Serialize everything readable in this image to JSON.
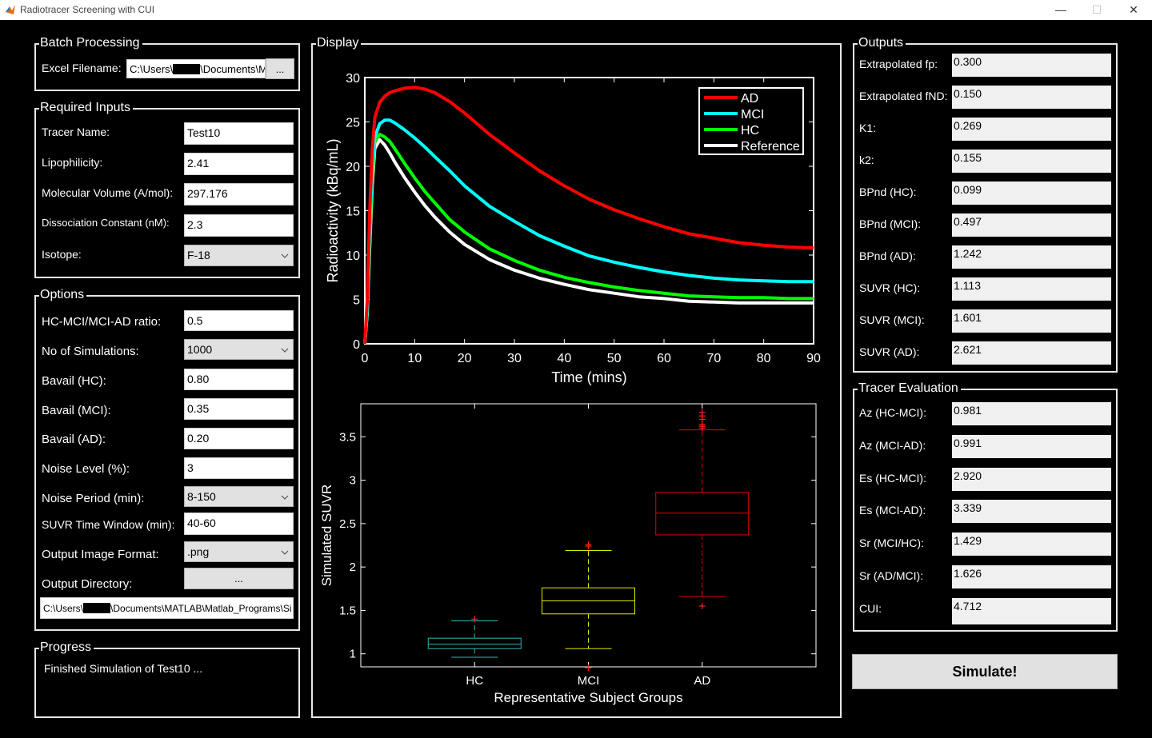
{
  "window": {
    "title": "Radiotracer Screening with CUI",
    "minimize": "—",
    "maximize": "☐",
    "close": "✕"
  },
  "batch": {
    "title": "Batch Processing",
    "excel_label": "Excel Filename:",
    "excel_path_prefix": "C:\\Users\\",
    "excel_path_suffix": "\\Documents\\M",
    "browse_label": "..."
  },
  "required": {
    "title": "Required Inputs",
    "fields": [
      {
        "label": "Tracer Name:",
        "value": "Test10"
      },
      {
        "label": "Lipophilicity:",
        "value": "2.41"
      },
      {
        "label": "Molecular Volume (A/mol):",
        "value": "297.176"
      },
      {
        "label": "Dissociation Constant (nM):",
        "value": "2.3"
      },
      {
        "label": "Isotope:",
        "value": "F-18"
      }
    ]
  },
  "options": {
    "title": "Options",
    "fields": [
      {
        "label": "HC-MCI/MCI-AD ratio:",
        "value": "0.5"
      },
      {
        "label": "No of Simulations:",
        "value": "1000"
      },
      {
        "label": "Bavail (HC):",
        "value": "0.80"
      },
      {
        "label": "Bavail (MCI):",
        "value": "0.35"
      },
      {
        "label": "Bavail (AD):",
        "value": "0.20"
      },
      {
        "label": "Noise Level (%):",
        "value": "3"
      },
      {
        "label": "Noise Period (min):",
        "value": "8-150"
      },
      {
        "label": "SUVR Time Window (min):",
        "value": "40-60"
      },
      {
        "label": "Output Image Format:",
        "value": ".png"
      },
      {
        "label": "Output Directory:",
        "value": "..."
      }
    ],
    "dir_path_prefix": "C:\\Users\\",
    "dir_path_suffix": "\\Documents\\MATLAB\\Matlab_Programs\\Si"
  },
  "progress": {
    "title": "Progress",
    "message": "Finished Simulation of Test10 ..."
  },
  "display": {
    "title": "Display"
  },
  "outputs": {
    "title": "Outputs",
    "items": [
      {
        "label": "Extrapolated fp:",
        "value": "0.300"
      },
      {
        "label": "Extrapolated fND:",
        "value": "0.150"
      },
      {
        "label": "K1:",
        "value": "0.269"
      },
      {
        "label": "k2:",
        "value": "0.155"
      },
      {
        "label": "BPnd (HC):",
        "value": "0.099"
      },
      {
        "label": "BPnd (MCI):",
        "value": "0.497"
      },
      {
        "label": "BPnd (AD):",
        "value": "1.242"
      },
      {
        "label": "SUVR (HC):",
        "value": "1.113"
      },
      {
        "label": "SUVR (MCI):",
        "value": "1.601"
      },
      {
        "label": "SUVR (AD):",
        "value": "2.621"
      }
    ]
  },
  "evaluation": {
    "title": "Tracer Evaluation",
    "items": [
      {
        "label": "Az (HC-MCI):",
        "value": "0.981"
      },
      {
        "label": "Az (MCI-AD):",
        "value": "0.991"
      },
      {
        "label": "Es (HC-MCI):",
        "value": "2.920"
      },
      {
        "label": "Es (MCI-AD):",
        "value": "3.339"
      },
      {
        "label": "Sr (MCI/HC):",
        "value": "1.429"
      },
      {
        "label": "Sr (AD/MCI):",
        "value": "1.626"
      },
      {
        "label": "CUI:",
        "value": "4.712"
      }
    ]
  },
  "simulate_label": "Simulate!",
  "chart_data": [
    {
      "type": "line",
      "xlabel": "Time (mins)",
      "ylabel": "Radioactivity (kBq/mL)",
      "xlim": [
        0,
        90
      ],
      "ylim": [
        0,
        30
      ],
      "xticks": [
        0,
        10,
        20,
        30,
        40,
        50,
        60,
        70,
        80,
        90
      ],
      "yticks": [
        0,
        5,
        10,
        15,
        20,
        25,
        30
      ],
      "legend_position": "top-right",
      "series": [
        {
          "name": "AD",
          "color": "#ff0000",
          "x": [
            0,
            0.5,
            1,
            1.5,
            2,
            3,
            4,
            5,
            6,
            8,
            10,
            12,
            14,
            17,
            20,
            25,
            30,
            35,
            40,
            45,
            50,
            55,
            60,
            65,
            70,
            75,
            80,
            85,
            90
          ],
          "y": [
            0,
            5,
            15,
            22,
            25.5,
            27.2,
            27.9,
            28.3,
            28.5,
            28.8,
            28.9,
            28.7,
            28.3,
            27.3,
            26.0,
            23.6,
            21.5,
            19.5,
            17.8,
            16.3,
            15.1,
            14.1,
            13.2,
            12.4,
            11.9,
            11.4,
            11.1,
            10.9,
            10.8
          ]
        },
        {
          "name": "MCI",
          "color": "#00ffff",
          "x": [
            0,
            0.5,
            1,
            1.5,
            2,
            3,
            4,
            5,
            6,
            8,
            10,
            12,
            14,
            17,
            20,
            25,
            30,
            35,
            40,
            45,
            50,
            55,
            60,
            65,
            70,
            75,
            80,
            85,
            90
          ],
          "y": [
            0,
            4,
            13,
            20,
            23.3,
            24.8,
            25.2,
            25.2,
            24.9,
            24.1,
            23.2,
            22.2,
            21.1,
            19.5,
            17.8,
            15.5,
            13.8,
            12.2,
            11.0,
            9.9,
            9.2,
            8.6,
            8.1,
            7.7,
            7.4,
            7.2,
            7.1,
            7.0,
            7.0
          ]
        },
        {
          "name": "HC",
          "color": "#00ff00",
          "x": [
            0,
            0.5,
            1,
            1.5,
            2,
            3,
            4,
            5,
            6,
            8,
            10,
            12,
            14,
            17,
            20,
            25,
            30,
            35,
            40,
            45,
            50,
            55,
            60,
            65,
            70,
            75,
            80,
            85,
            90
          ],
          "y": [
            0,
            4,
            12,
            19,
            22.8,
            23.6,
            23.3,
            22.8,
            22.0,
            20.3,
            18.7,
            17.2,
            15.9,
            14.0,
            12.6,
            10.7,
            9.4,
            8.3,
            7.5,
            6.9,
            6.4,
            6.0,
            5.7,
            5.4,
            5.3,
            5.2,
            5.2,
            5.1,
            5.1
          ]
        },
        {
          "name": "Reference",
          "color": "#ffffff",
          "x": [
            0,
            0.5,
            1,
            1.5,
            2,
            3,
            4,
            5,
            6,
            8,
            10,
            12,
            14,
            17,
            20,
            25,
            30,
            35,
            40,
            45,
            50,
            55,
            60,
            65,
            70,
            75,
            80,
            85,
            90
          ],
          "y": [
            0,
            3.5,
            11,
            18,
            22,
            23.0,
            22.4,
            21.5,
            20.5,
            18.7,
            17.1,
            15.6,
            14.3,
            12.6,
            11.2,
            9.5,
            8.3,
            7.4,
            6.7,
            6.1,
            5.7,
            5.3,
            5.1,
            4.8,
            4.7,
            4.6,
            4.6,
            4.6,
            4.6
          ]
        }
      ]
    },
    {
      "type": "box",
      "xlabel": "Representative Subject Groups",
      "ylabel": "Simulated SUVR",
      "categories": [
        "HC",
        "MCI",
        "AD"
      ],
      "ylim": [
        0.85,
        3.88
      ],
      "yticks": [
        1,
        1.5,
        2,
        2.5,
        3,
        3.5
      ],
      "yticklabels": [
        "1",
        "1.5",
        "2",
        "2.5",
        "3",
        "3.5"
      ],
      "boxes": [
        {
          "category": "HC",
          "color": "#2eb8b8",
          "whisker_low": 0.96,
          "q1": 1.06,
          "median": 1.11,
          "q3": 1.18,
          "whisker_high": 1.38,
          "outliers": [
            1.4
          ]
        },
        {
          "category": "MCI",
          "color": "#e6e600",
          "whisker_low": 1.06,
          "q1": 1.46,
          "median": 1.61,
          "q3": 1.76,
          "whisker_high": 2.19,
          "outliers": [
            0.84,
            2.24,
            2.26
          ]
        },
        {
          "category": "AD",
          "color": "#e60000",
          "whisker_low": 1.66,
          "q1": 2.37,
          "median": 2.62,
          "q3": 2.86,
          "whisker_high": 3.58,
          "outliers": [
            1.55,
            3.6,
            3.62,
            3.64,
            3.7,
            3.74,
            3.78
          ]
        }
      ]
    }
  ]
}
